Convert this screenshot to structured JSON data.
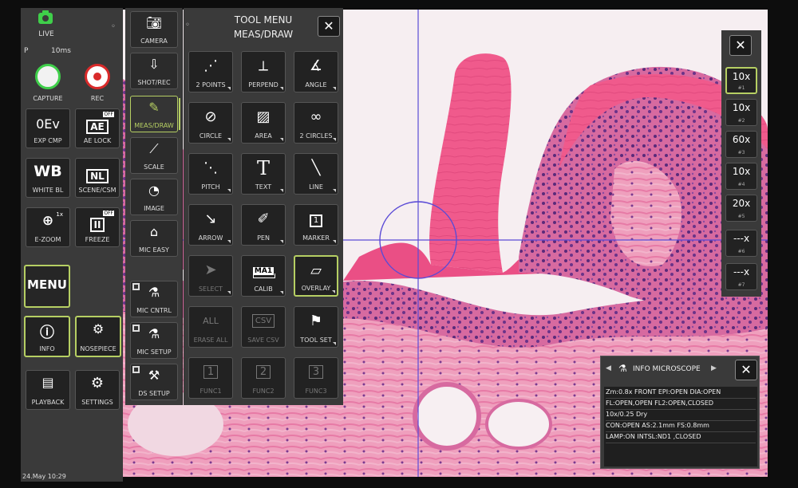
{
  "left_bar": {
    "live": "LIVE",
    "mode": "P",
    "exposure": "10ms",
    "capture": "CAPTURE",
    "rec": "REC",
    "exp_cmp_value": "0Ev",
    "exp_cmp": "EXP CMP",
    "ae_lock_glyph": "AE",
    "ae_lock_badge": "OFF",
    "ae_lock": "AE LOCK",
    "wb_glyph": "WB",
    "white_bl": "WHITE BL",
    "nl_glyph": "NL",
    "scene": "SCENE/CSM",
    "ezoom_badge": "1x",
    "ezoom": "E-ZOOM",
    "freeze_badge": "OFF",
    "freeze": "FREEZE",
    "menu": "MENU",
    "info": "INFO",
    "nosepiece": "NOSEPIECE",
    "playback": "PLAYBACK",
    "settings": "SETTINGS",
    "datetime": "24.May 10:29"
  },
  "categories": {
    "camera": "CAMERA",
    "shot_rec": "SHOT/REC",
    "meas_draw": "MEAS/DRAW",
    "scale": "SCALE",
    "image": "IMAGE",
    "mic_easy": "MIC EASY",
    "mic_cntrl": "MIC CNTRL",
    "mic_setup": "MIC SETUP",
    "ds_setup": "DS SETUP"
  },
  "tool_menu": {
    "title_line1": "TOOL MENU",
    "title_line2": "MEAS/DRAW",
    "close": "✕",
    "tools": [
      {
        "label": "2 POINTS"
      },
      {
        "label": "PERPEND"
      },
      {
        "label": "ANGLE"
      },
      {
        "label": "CIRCLE"
      },
      {
        "label": "AREA"
      },
      {
        "label": "2 CIRCLES"
      },
      {
        "label": "PITCH"
      },
      {
        "label": "TEXT",
        "glyph": "T"
      },
      {
        "label": "LINE"
      },
      {
        "label": "ARROW"
      },
      {
        "label": "PEN"
      },
      {
        "label": "MARKER",
        "glyph": "1"
      },
      {
        "label": "SELECT"
      },
      {
        "label": "CALIB",
        "glyph": "MA1"
      },
      {
        "label": "OVERLAY"
      },
      {
        "label": "ERASE ALL",
        "glyph": "ALL"
      },
      {
        "label": "SAVE CSV",
        "glyph": "CSV"
      },
      {
        "label": "TOOL SET"
      },
      {
        "label": "FUNC1",
        "glyph": "1"
      },
      {
        "label": "FUNC2",
        "glyph": "2"
      },
      {
        "label": "FUNC3",
        "glyph": "3"
      }
    ]
  },
  "objectives": {
    "close": "✕",
    "items": [
      {
        "mag": "10x",
        "num": "#1"
      },
      {
        "mag": "10x",
        "num": "#2"
      },
      {
        "mag": "60x",
        "num": "#3"
      },
      {
        "mag": "10x",
        "num": "#4"
      },
      {
        "mag": "20x",
        "num": "#5"
      },
      {
        "mag": "---x",
        "num": "#6"
      },
      {
        "mag": "---x",
        "num": "#7"
      }
    ]
  },
  "info_panel": {
    "left_arrow": "◀",
    "title": "INFO MICROSCOPE",
    "right_arrow": "▶",
    "close": "✕",
    "lines": [
      "Zm:0.8x FRONT  EPI:OPEN   DIA:OPEN",
      "FL:OPEN,OPEN    FL2:OPEN,CLOSED",
      " 10x/0.25 Dry",
      "CON:OPEN   AS:2.1mm FS:0.8mm",
      "LAMP:ON   INTSL:ND1 ,CLOSED"
    ]
  },
  "colors": {
    "accent": "#b6cf63",
    "live": "#3fcf4a",
    "rec": "#d92a2a",
    "crosshair": "#5b4bd6"
  }
}
